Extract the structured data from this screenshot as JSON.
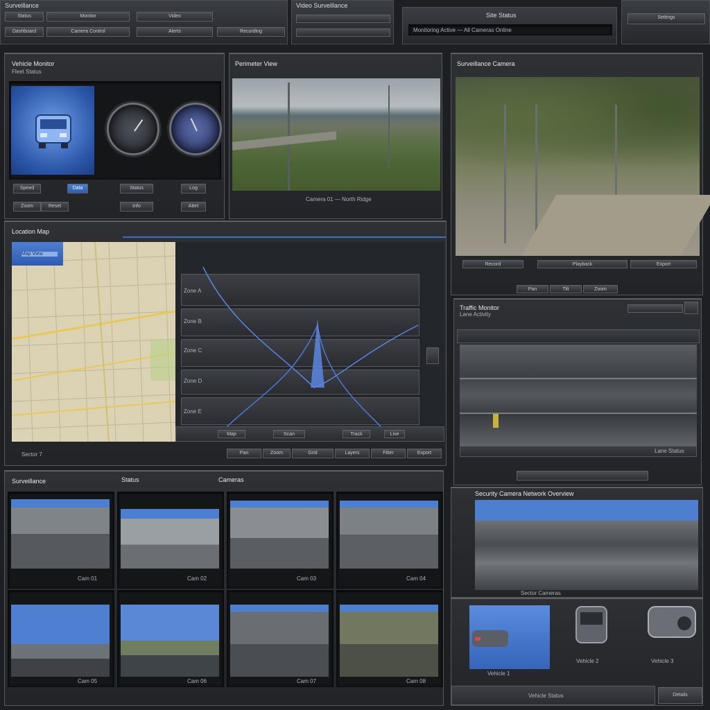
{
  "topbar": {
    "tabs": [
      "Surveillance",
      "Status",
      "Monitor",
      "Video"
    ],
    "rows": [
      "Dashboard",
      "Camera Control",
      "Alerts",
      "Recording"
    ],
    "center_title": "Video Surveillance",
    "status_title": "Site Status",
    "status_line": "Monitoring Active — All Cameras Online",
    "right_title": "Settings"
  },
  "vehicle_panel": {
    "title": "Vehicle Monitor",
    "subtitle": "Fleet Status",
    "btns": [
      "Speed",
      "Data",
      "Status",
      "Log"
    ],
    "btns2": [
      "Zoom",
      "Reset",
      "Info",
      "Alert"
    ]
  },
  "cam1": {
    "title": "Perimeter View",
    "caption": "Camera 01 — North Ridge"
  },
  "cam2": {
    "title": "Surveillance Camera",
    "btns": [
      "Record",
      "Playback",
      "Export"
    ],
    "btns2": [
      "Pan",
      "Tilt",
      "Zoom"
    ]
  },
  "map_panel": {
    "title": "Location Map",
    "tab": "Map View",
    "overlay": "Sector 7",
    "rows": [
      "Zone A",
      "Zone B",
      "Zone C",
      "Zone D",
      "Zone E"
    ],
    "footer": [
      "Map",
      "Scan",
      "Track",
      "Live"
    ],
    "controls": [
      "Pan",
      "Zoom",
      "Grid",
      "Layers",
      "Filter",
      "Export"
    ]
  },
  "traffic_panel": {
    "title": "Traffic Monitor",
    "subtitle": "Lane Activity",
    "footer": "Lane Status"
  },
  "security_panel": {
    "title": "Security Camera Network Overview",
    "footer": "Sector Cameras"
  },
  "vehicles": {
    "labels": [
      "Vehicle 1",
      "Vehicle 2",
      "Vehicle 3"
    ],
    "footer": "Vehicle Status",
    "btn": "Details"
  },
  "grid": {
    "headers": [
      "Surveillance",
      "Status",
      "Cameras"
    ],
    "captions": [
      "Cam 01",
      "Cam 02",
      "Cam 03",
      "Cam 04",
      "Cam 05",
      "Cam 06",
      "Cam 07",
      "Cam 08"
    ]
  }
}
